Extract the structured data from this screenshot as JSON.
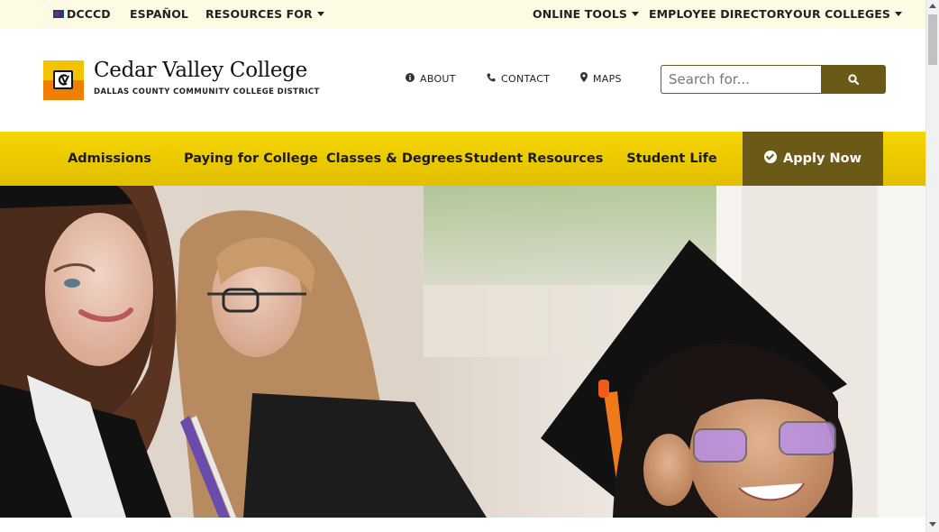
{
  "utility_bar": {
    "dcccd": "DCCCD",
    "espanol": "ESPAÑOL",
    "resources_for": "RESOURCES FOR",
    "online_tools": "ONLINE TOOLS",
    "employee_directory": "EMPLOYEE DIRECTORY",
    "our_colleges": "OUR COLLEGES"
  },
  "header": {
    "college_name": "Cedar Valley College",
    "district_name": "DALLAS COUNTY COMMUNITY COLLEGE DISTRICT",
    "links": {
      "about": "ABOUT",
      "contact": "CONTACT",
      "maps": "MAPS"
    },
    "search": {
      "placeholder": "Search for...",
      "value": ""
    }
  },
  "main_nav": {
    "items": [
      "Admissions",
      "Paying for College",
      "Classes & Degrees",
      "Student Resources",
      "Student Life"
    ],
    "apply_now": "Apply Now"
  },
  "colors": {
    "utility_bg": "#fdfbe3",
    "nav_yellow": "#f5d500",
    "brand_olive": "#6b5a17",
    "logo_yellow": "#f2c300",
    "logo_orange": "#f07f00"
  },
  "icons": {
    "about": "info-circle-icon",
    "contact": "phone-icon",
    "maps": "map-marker-icon",
    "search": "search-icon",
    "apply": "check-circle-icon"
  }
}
